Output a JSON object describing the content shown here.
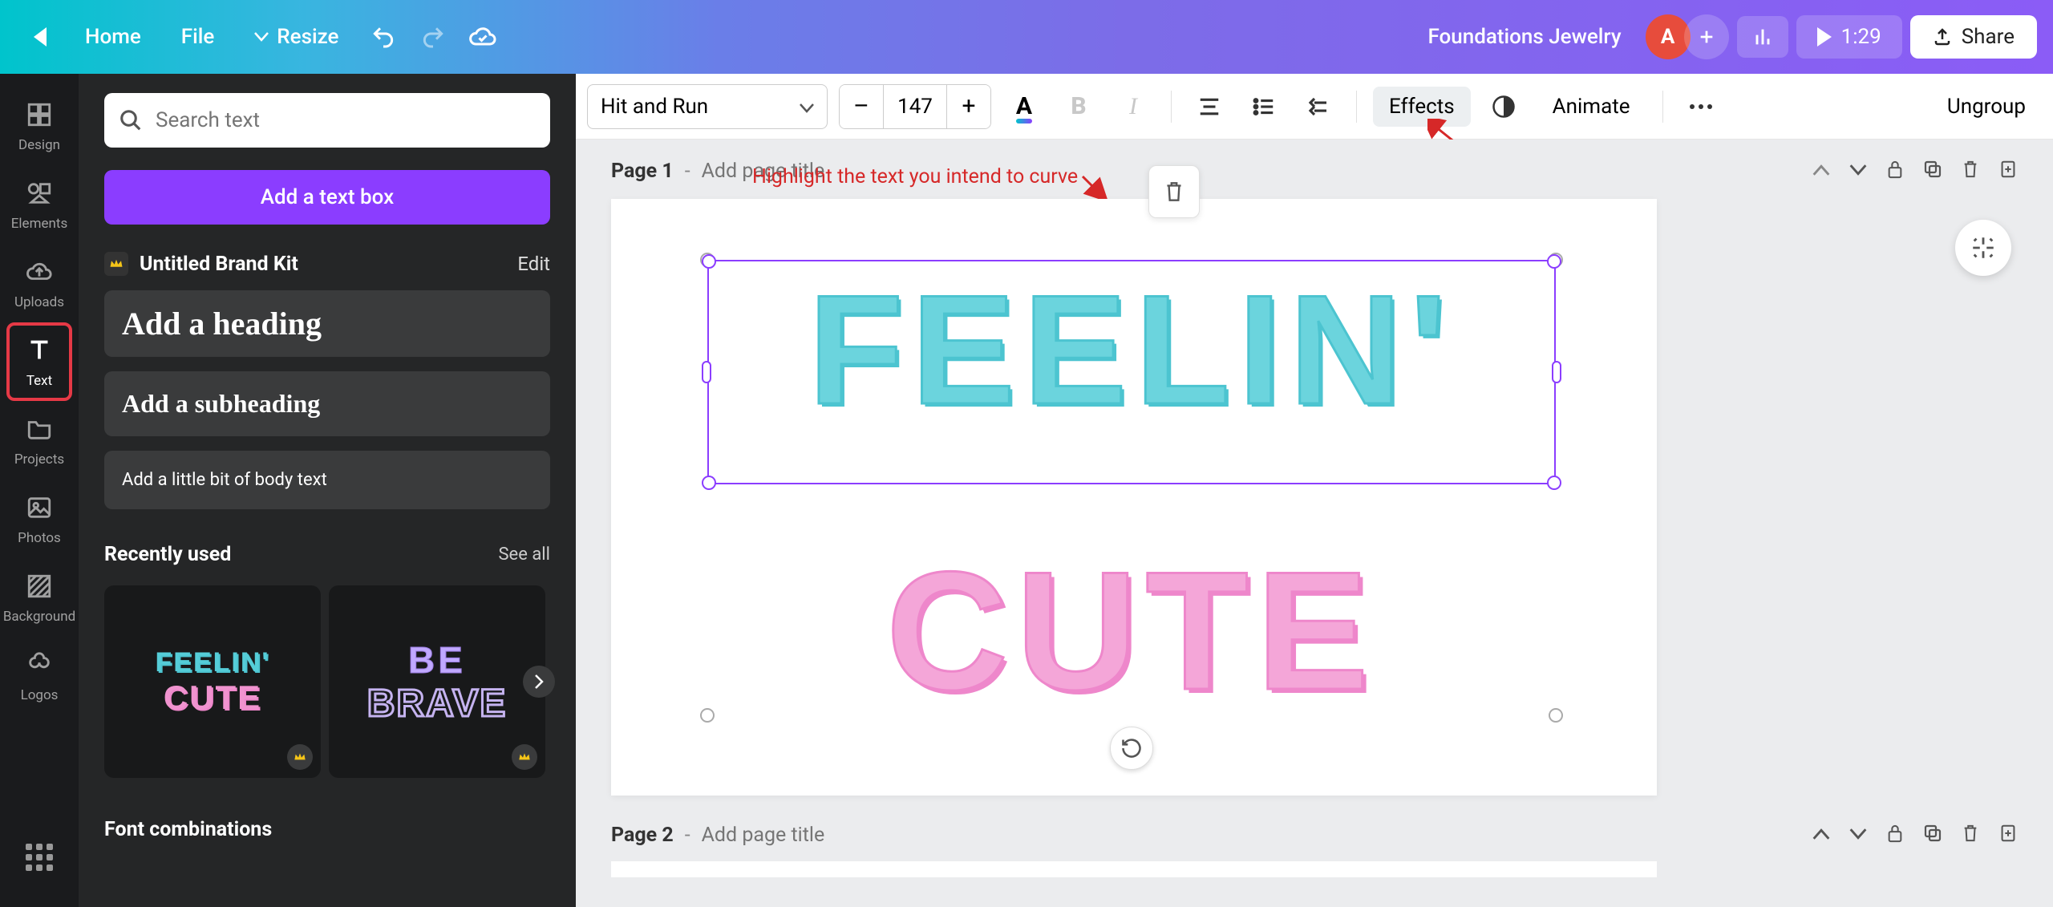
{
  "topbar": {
    "home": "Home",
    "file": "File",
    "resize": "Resize",
    "doc_title": "Foundations Jewelry",
    "avatar_letter": "A",
    "duration": "1:29",
    "share": "Share"
  },
  "rail": {
    "items": [
      {
        "label": "Design"
      },
      {
        "label": "Elements"
      },
      {
        "label": "Uploads"
      },
      {
        "label": "Text"
      },
      {
        "label": "Projects"
      },
      {
        "label": "Photos"
      },
      {
        "label": "Background"
      },
      {
        "label": "Logos"
      }
    ]
  },
  "panel": {
    "search_placeholder": "Search text",
    "add_text_box": "Add a text box",
    "brand_kit": "Untitled Brand Kit",
    "edit": "Edit",
    "heading": "Add a heading",
    "subheading": "Add a subheading",
    "body": "Add a little bit of body text",
    "recently_used": "Recently used",
    "see_all": "See all",
    "thumbs": {
      "t1_line1": "FEELIN'",
      "t1_line2": "CUTE",
      "t2_line1": "BE",
      "t2_line2": "BRAVE"
    },
    "font_combinations": "Font combinations"
  },
  "ctx": {
    "font_name": "Hit and Run",
    "minus": "–",
    "size": "147",
    "plus": "+",
    "effects": "Effects",
    "animate": "Animate",
    "ungroup": "Ungroup"
  },
  "annotation": {
    "highlight_text": "Highlight the text you intend to curve"
  },
  "canvas": {
    "page1_label": "Page 1",
    "page2_label": "Page 2",
    "dash": "-",
    "page_title_placeholder": "Add page title",
    "text_line1": "FEELIN'",
    "text_line2": "CUTE"
  }
}
